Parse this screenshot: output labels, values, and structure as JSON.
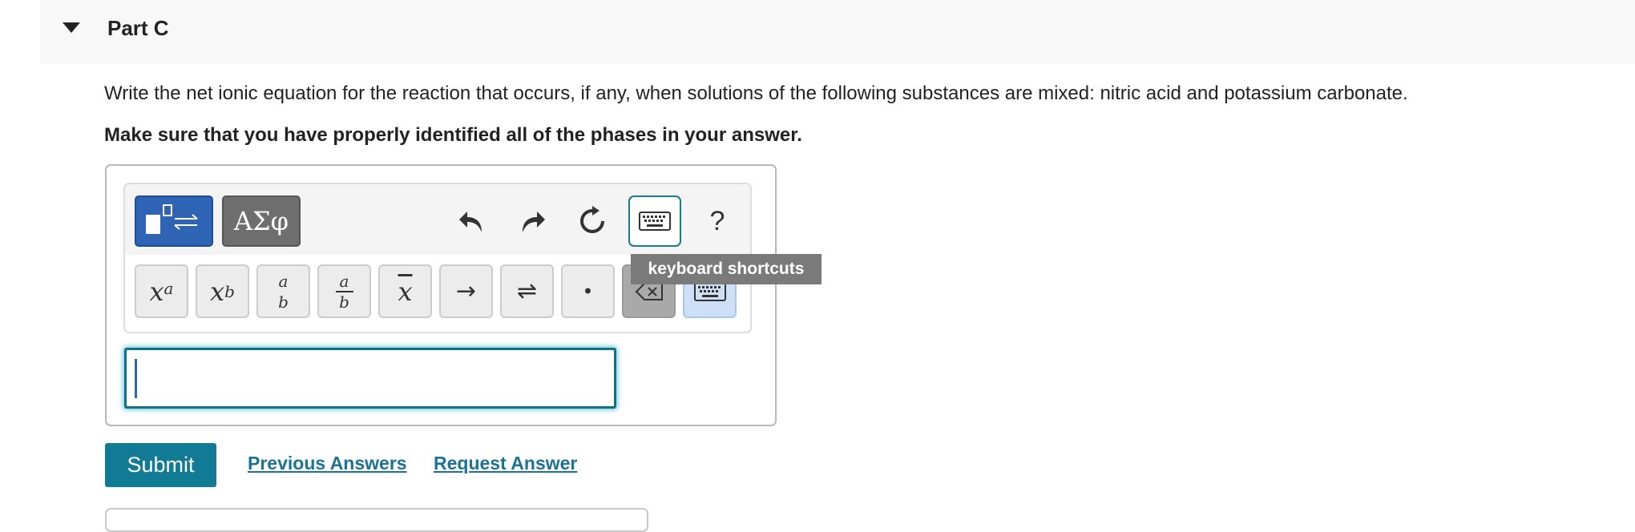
{
  "part": {
    "title": "Part C"
  },
  "question": {
    "text": "Write the net ionic equation for the reaction that occurs, if any, when solutions of the following substances are mixed: nitric acid and potassium carbonate.",
    "instruction": "Make sure that you have properly identified all of the phases in your answer."
  },
  "toolbar": {
    "mode_templates_icon": "templates-equilibrium-icon",
    "mode_symbols_label": "ΑΣφ",
    "undo_icon": "undo-icon",
    "redo_icon": "redo-icon",
    "reset_icon": "reset-icon",
    "keyboard_icon": "keyboard-icon",
    "help_label": "?",
    "tooltip": "keyboard shortcuts"
  },
  "keys": {
    "superscript": {
      "base": "x",
      "exp": "a"
    },
    "subscript": {
      "base": "x",
      "sub": "b"
    },
    "stacked": {
      "top": "a",
      "bottom": "b"
    },
    "fraction": {
      "top": "a",
      "bottom": "b"
    },
    "overline": {
      "base": "x"
    },
    "arrow_label": "→",
    "equilibrium_label": "⇌",
    "dot_label": "•"
  },
  "answer": {
    "value": ""
  },
  "actions": {
    "submit_label": "Submit",
    "previous_answers_label": "Previous Answers",
    "request_answer_label": "Request Answer"
  },
  "colors": {
    "primary_teal": "#117a94",
    "link_teal": "#1a7294",
    "mode_active_blue": "#2e64b3",
    "tooltip_gray": "#7a7a7a"
  }
}
